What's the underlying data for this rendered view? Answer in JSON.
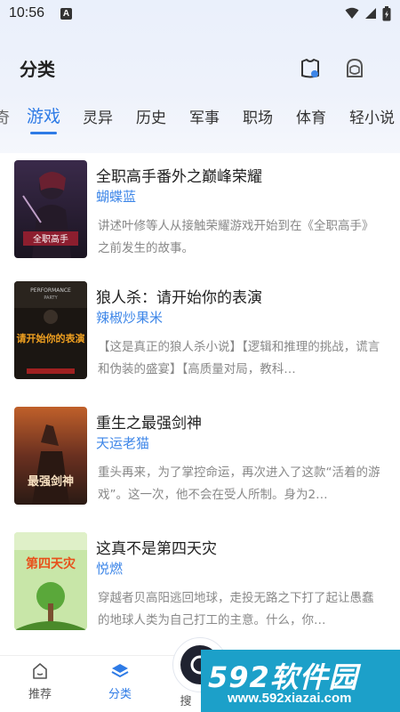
{
  "status_bar": {
    "time": "10:56",
    "notification_badge": "A"
  },
  "header": {
    "title": "分类"
  },
  "tabs": {
    "items": [
      {
        "label": "游戏",
        "active": true
      },
      {
        "label": "灵异",
        "active": false
      },
      {
        "label": "历史",
        "active": false
      },
      {
        "label": "军事",
        "active": false
      },
      {
        "label": "职场",
        "active": false
      },
      {
        "label": "体育",
        "active": false
      },
      {
        "label": "轻小说",
        "active": false
      }
    ]
  },
  "books": [
    {
      "title": "全职高手番外之巅峰荣耀",
      "author": "蝴蝶蓝",
      "description": "讲述叶修等人从接触荣耀游戏开始到在《全职高手》之前发生的故事。",
      "cover_text": "全职高手"
    },
    {
      "title": "狼人杀：请开始你的表演",
      "author": "辣椒炒果米",
      "description": "【这是真正的狼人杀小说】【逻辑和推理的挑战，谎言和伪装的盛宴】【高质量对局，教科…",
      "cover_text": "请开始你的表演"
    },
    {
      "title": "重生之最强剑神",
      "author": "天运老猫",
      "description": "重头再来，为了掌控命运，再次进入了这款“活着的游戏”。这一次，他不会在受人所制。身为2…",
      "cover_text": "最强剑神"
    },
    {
      "title": "这真不是第四天灾",
      "author": "悦燃",
      "description": "穿越者贝高阳逃回地球，走投无路之下打了起让愚蠢的地球人类为自己打工的主意。什么，你…",
      "cover_text": "第四天灾"
    }
  ],
  "bottom_nav": {
    "items": [
      {
        "label": "推荐",
        "active": false
      },
      {
        "label": "分类",
        "active": true
      },
      {
        "label": "搜",
        "active": false
      }
    ]
  },
  "watermark": {
    "logo": "592软件园",
    "url": "www.592xiazai.com"
  },
  "colors": {
    "accent": "#2e7be6",
    "author": "#3d86e8",
    "watermark_bg": "#1ca0c9"
  }
}
